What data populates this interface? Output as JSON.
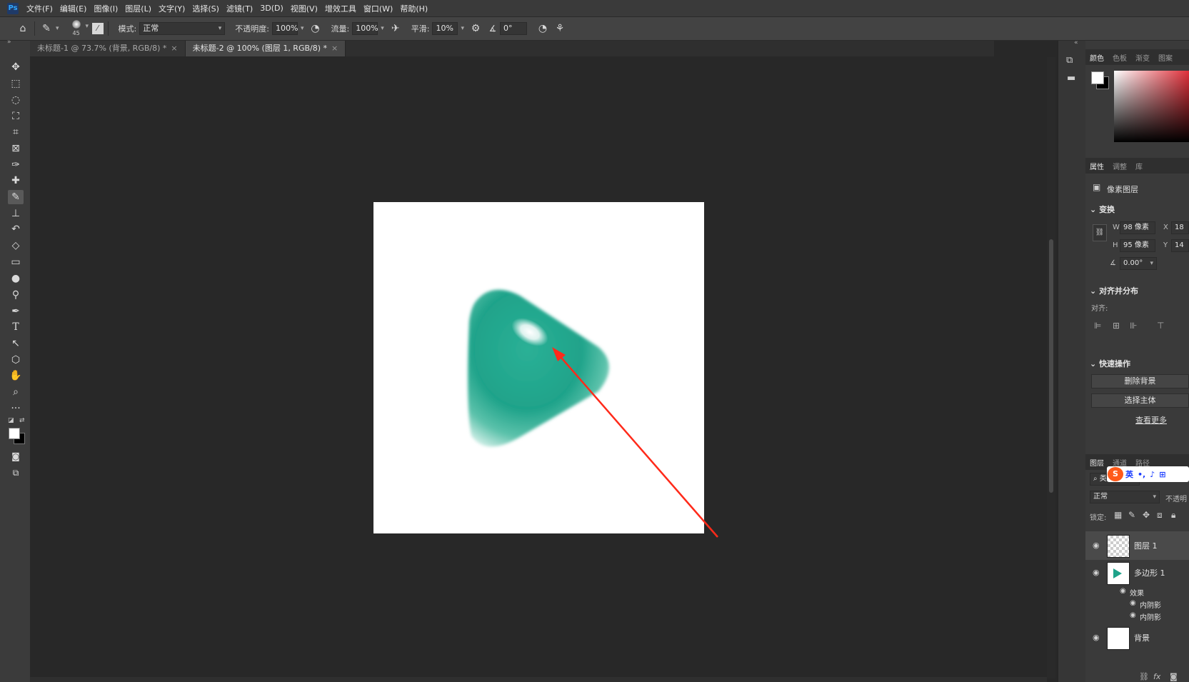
{
  "menu": [
    "文件(F)",
    "编辑(E)",
    "图像(I)",
    "图层(L)",
    "文字(Y)",
    "选择(S)",
    "滤镜(T)",
    "3D(D)",
    "视图(V)",
    "增效工具",
    "窗口(W)",
    "帮助(H)"
  ],
  "app_logo": "Ps",
  "options": {
    "brush_size": "45",
    "mode_label": "模式:",
    "mode_value": "正常",
    "opacity_label": "不透明度:",
    "opacity_value": "100%",
    "flow_label": "流量:",
    "flow_value": "100%",
    "smooth_label": "平滑:",
    "smooth_value": "10%",
    "angle_value": "0°"
  },
  "tabs": [
    {
      "label": "未标题-1 @ 73.7% (背景, RGB/8) *",
      "active": false
    },
    {
      "label": "未标题-2 @ 100% (图层 1, RGB/8) *",
      "active": true
    }
  ],
  "tools": [
    "move-tool",
    "marquee-tool",
    "lasso-tool",
    "object-select-tool",
    "crop-tool",
    "frame-tool",
    "eyedropper-tool",
    "healing-brush-tool",
    "brush-tool",
    "stamp-tool",
    "history-brush-tool",
    "eraser-tool",
    "gradient-tool",
    "blur-tool",
    "dodge-tool",
    "pen-tool",
    "type-tool",
    "path-select-tool",
    "shape-tool",
    "hand-tool",
    "zoom-tool",
    "more-tools"
  ],
  "colors": {
    "teal": "#1fa38a",
    "teal_light": "#79cdb9",
    "arrow": "#ff2a1a",
    "doc_bg": "#ffffff"
  },
  "panel": {
    "color_tabs": [
      "颜色",
      "色板",
      "渐变",
      "图案"
    ],
    "props_tabs": [
      "属性",
      "调整",
      "库"
    ],
    "pixel_layer": "像素图层",
    "transform_title": "变换",
    "w_label": "W",
    "w_value": "98 像素",
    "h_label": "H",
    "h_value": "95 像素",
    "x_label": "X",
    "x_value": "18",
    "y_label": "Y",
    "y_value": "14",
    "angle_value": "0.00°",
    "align_title": "对齐并分布",
    "align_label": "对齐:",
    "quick_title": "快速操作",
    "remove_bg": "删除背景",
    "select_subject": "选择主体",
    "see_more": "查看更多",
    "layers_tabs": [
      "图层",
      "通道",
      "路径"
    ],
    "kind_label": "类型",
    "blend_mode": "正常",
    "opacity_short": "不透明",
    "lock_label": "锁定:",
    "ime": "英",
    "layers": [
      {
        "name": "图层 1"
      },
      {
        "name": "多边形 1"
      },
      {
        "name": "效果"
      },
      {
        "name": "内阴影"
      },
      {
        "name": "内阴影"
      },
      {
        "name": "背景"
      }
    ]
  }
}
